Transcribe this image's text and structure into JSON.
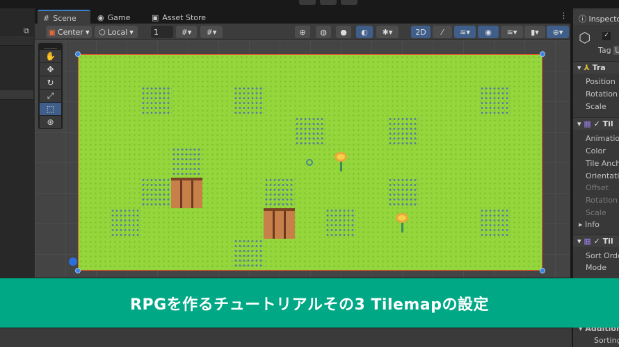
{
  "tabs": [
    {
      "label": "Scene",
      "icon": "grid-icon"
    },
    {
      "label": "Game",
      "icon": "gamepad-icon"
    },
    {
      "label": "Asset Store",
      "icon": "bag-icon"
    }
  ],
  "toolbar": {
    "pivot": "Center",
    "space": "Local",
    "grid_size": "1",
    "mode_2d": "2D"
  },
  "tools": [
    "hand-tool",
    "move-tool",
    "rotate-tool",
    "scale-tool",
    "rect-tool",
    "transform-tool"
  ],
  "inspector": {
    "title": "Inspector",
    "tag_label": "Tag",
    "tag_value": "U",
    "transform": {
      "header": "Tra",
      "props": [
        "Position",
        "Rotation",
        "Scale"
      ]
    },
    "tilemap": {
      "header": "Til",
      "props": [
        "Animation",
        "Color",
        "Tile Ancho",
        "Orientatio",
        "Offset",
        "Rotation",
        "Scale"
      ],
      "info": "Info"
    },
    "renderer": {
      "header": "Til",
      "props": [
        "Sort Order",
        "Mode"
      ]
    },
    "additional": {
      "header": "Additiona",
      "props": [
        "Sorting"
      ]
    }
  },
  "banner": {
    "text": "RPGを作るチュートリアルその3 Tilemapの設定",
    "color": "#00a885"
  },
  "colors": {
    "accent": "#3d7ec8",
    "grass": "#94d63c",
    "selection": "#e2552b"
  }
}
